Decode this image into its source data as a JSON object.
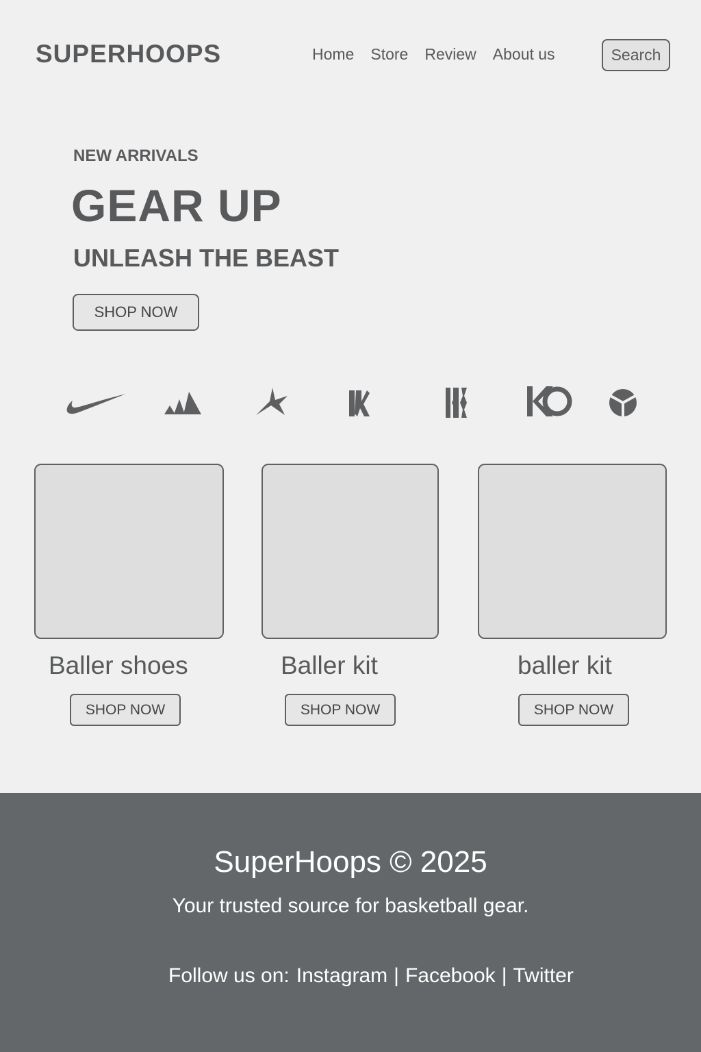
{
  "header": {
    "logo": "SUPERHOOPS",
    "nav": [
      "Home",
      "Store",
      "Review",
      "About us"
    ],
    "search_label": "Search"
  },
  "hero": {
    "eyebrow": "NEW ARRIVALS",
    "title": "GEAR UP",
    "subtitle": "UNLEASH THE BEAST",
    "cta": "SHOP NOW"
  },
  "brands": [
    "nike-swoosh-icon",
    "adidas-stripes-icon",
    "star-brand-icon",
    "kyrie-monogram-icon",
    "lebron-monogram-icon",
    "kd-logo-icon",
    "curry-logo-icon"
  ],
  "products": [
    {
      "title": "Baller shoes",
      "cta": "SHOP NOW"
    },
    {
      "title": "Baller kit",
      "cta": "SHOP NOW"
    },
    {
      "title": "baller kit",
      "cta": "SHOP NOW"
    }
  ],
  "footer": {
    "title": "SuperHoops © 2025",
    "tagline": "Your trusted source for basketball gear.",
    "follow_label": "Follow us on:",
    "social": [
      "Instagram",
      "Facebook",
      "Twitter"
    ],
    "separator": "|"
  },
  "colors": {
    "background": "#f0f0f0",
    "text": "#58595b",
    "footer_bg": "#646769",
    "card_bg": "#dedede"
  }
}
